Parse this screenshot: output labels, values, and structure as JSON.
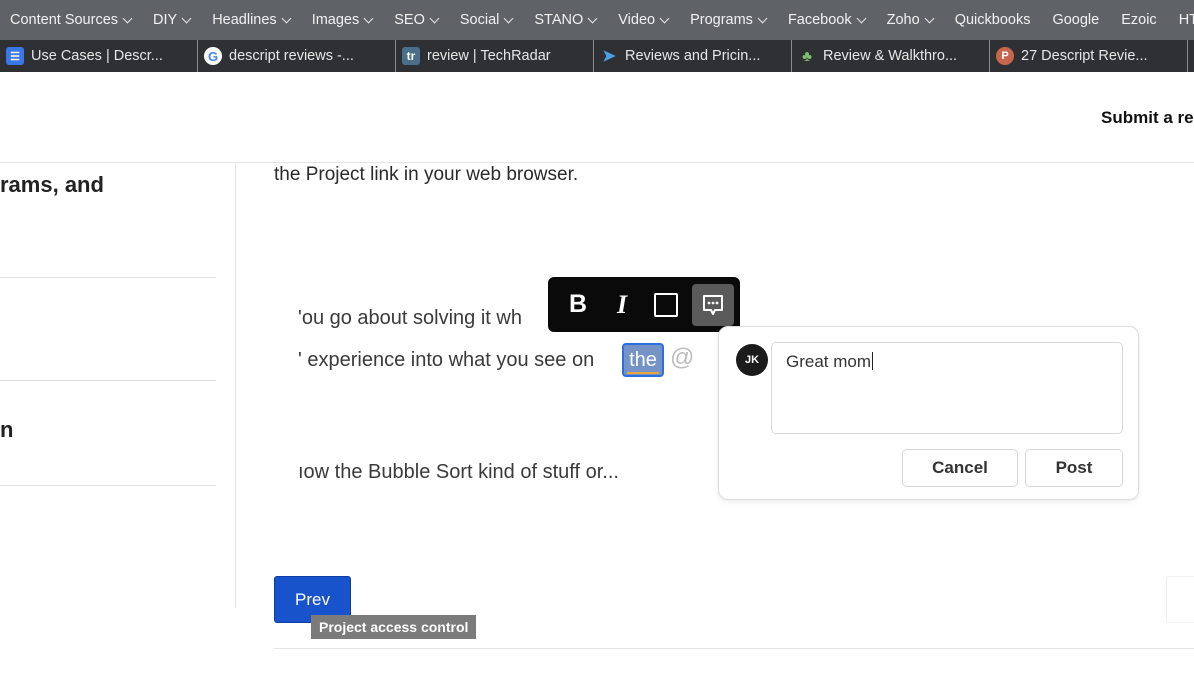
{
  "bookmarks": {
    "folders": [
      {
        "label": "Content Sources",
        "dropdown": true
      },
      {
        "label": "DIY",
        "dropdown": true
      },
      {
        "label": "Headlines",
        "dropdown": true
      },
      {
        "label": "Images",
        "dropdown": true
      },
      {
        "label": "SEO",
        "dropdown": true
      },
      {
        "label": "Social",
        "dropdown": true
      },
      {
        "label": "STANO",
        "dropdown": true
      },
      {
        "label": "Video",
        "dropdown": true
      },
      {
        "label": "Programs",
        "dropdown": true
      },
      {
        "label": "Facebook",
        "dropdown": true
      },
      {
        "label": "Zoho",
        "dropdown": true
      },
      {
        "label": "Quickbooks",
        "dropdown": false
      },
      {
        "label": "Google",
        "dropdown": false
      },
      {
        "label": "Ezoic",
        "dropdown": false
      },
      {
        "label": "HTM",
        "dropdown": false
      }
    ]
  },
  "tabs": [
    {
      "title": "Use Cases | Descr...",
      "icon": "doc-icon",
      "glyph": "☰"
    },
    {
      "title": "descript reviews -...",
      "icon": "google-icon",
      "glyph": "G"
    },
    {
      "title": "review | TechRadar",
      "icon": "techradar-icon",
      "glyph": "tr"
    },
    {
      "title": "Reviews and Pricin...",
      "icon": "send-icon",
      "glyph": "➤"
    },
    {
      "title": "Review & Walkthro...",
      "icon": "tree-icon",
      "glyph": "♣"
    },
    {
      "title": "27 Descript Revie...",
      "icon": "p-icon",
      "glyph": "P"
    }
  ],
  "page": {
    "submit_link": "Submit a re",
    "left_items": [
      "rams, and",
      "n"
    ],
    "intro_text": "the Project link in your web browser.",
    "transcript": {
      "line1": "'ou go about solving it wh",
      "line2": "' experience into what you see on",
      "selected_word": "the",
      "mention_glyph": "@",
      "line3": "ıow the Bubble Sort kind of stuff or..."
    },
    "toolbar": {
      "bold": "B",
      "italic": "I"
    },
    "comment": {
      "avatar_initials": "JK",
      "input_value": "Great mom",
      "cancel_label": "Cancel",
      "post_label": "Post"
    },
    "prev_label": "Prev",
    "tooltip": "Project access control"
  },
  "colors": {
    "bookmarks_bg": "#5f6266",
    "tabs_bg": "#2e3033",
    "toolbar_bg": "#0a0a0a",
    "selection_bg": "#7693c8",
    "selection_border": "#2e6fe0",
    "prev_button": "#1953cc",
    "tooltip_bg": "#7b7b7b"
  }
}
